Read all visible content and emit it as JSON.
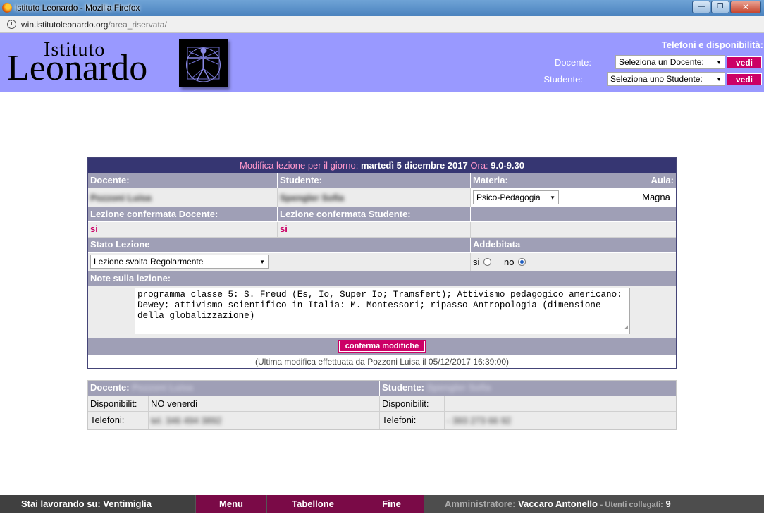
{
  "browser": {
    "window_title": "Istituto Leonardo - Mozilla Firefox",
    "url_host": "win.istitutoleonardo.org",
    "url_path": "/area_riservata/",
    "minimize": "—",
    "maximize": "❐",
    "close": "✕"
  },
  "header": {
    "logo_line1": "Istituto",
    "logo_line2": "Leonardo",
    "section_title": "Telefoni e disponibilità:",
    "docente_label": "Docente:",
    "docente_select": "Seleziona un Docente:",
    "studente_label": "Studente:",
    "studente_select": "Seleziona uno Studente:",
    "vedi": "vedi"
  },
  "lesson": {
    "title_prefix": "Modifica lezione per il giorno:",
    "date": "martedì 5 dicembre 2017",
    "ora_label": "Ora:",
    "ora": "9.0-9.30",
    "docente_header": "Docente:",
    "studente_header": "Studente:",
    "materia_header": "Materia:",
    "aula_header": "Aula:",
    "docente_name": "Pozzoni Luisa",
    "studente_name": "Spengler Sofia",
    "materia": "Psico-Pedagogia",
    "aula": "Magna",
    "conf_docente_header": "Lezione confermata Docente:",
    "conf_studente_header": "Lezione confermata Studente:",
    "conf_docente": "si",
    "conf_studente": "si",
    "stato_header": "Stato Lezione",
    "addebitata_header": "Addebitata",
    "stato": "Lezione svolta Regolarmente",
    "addebitata_si": "si",
    "addebitata_no": "no",
    "addebitata_selected": "no",
    "note_header": "Note sulla lezione:",
    "note": "programma classe 5: S. Freud (Es, Io, Super Io; Tramsfert); Attivismo pedagogico americano: Dewey; attivismo scientifico in Italia: M. Montessori; ripasso Antropologia (dimensione della globalizzazione)",
    "confirm_button": "conferma modifiche",
    "last_modified": "(Ultima modifica effettuata da Pozzoni Luisa il 05/12/2017 16:39:00)"
  },
  "info": {
    "docente_label": "Docente:",
    "docente_name": "Pozzoni Luisa",
    "studente_label": "Studente:",
    "studente_name": "Spengler Sofia",
    "disp_label": "Disponibilit:",
    "docente_disp": "NO venerdì",
    "studente_disp_label": "Disponibilit:",
    "studente_disp": "",
    "tel_label": "Telefoni:",
    "docente_tel": "tel. 346 494 3892",
    "studente_tel_label": "Telefoni:",
    "studente_tel": "- 393 273 66 92"
  },
  "footer": {
    "working_on": "Stai lavorando su: Ventimiglia",
    "menu": "Menu",
    "tabellone": "Tabellone",
    "fine": "Fine",
    "admin_label": "Amministratore:",
    "admin_name": "Vaccaro Antonello",
    "users_label": "- Utenti collegati:",
    "users_count": "9"
  },
  "colors": {
    "header_bg": "#9999ff",
    "accent": "#cc0066",
    "table_title_bg": "#363672",
    "table_header_bg": "#9f9fb6"
  }
}
